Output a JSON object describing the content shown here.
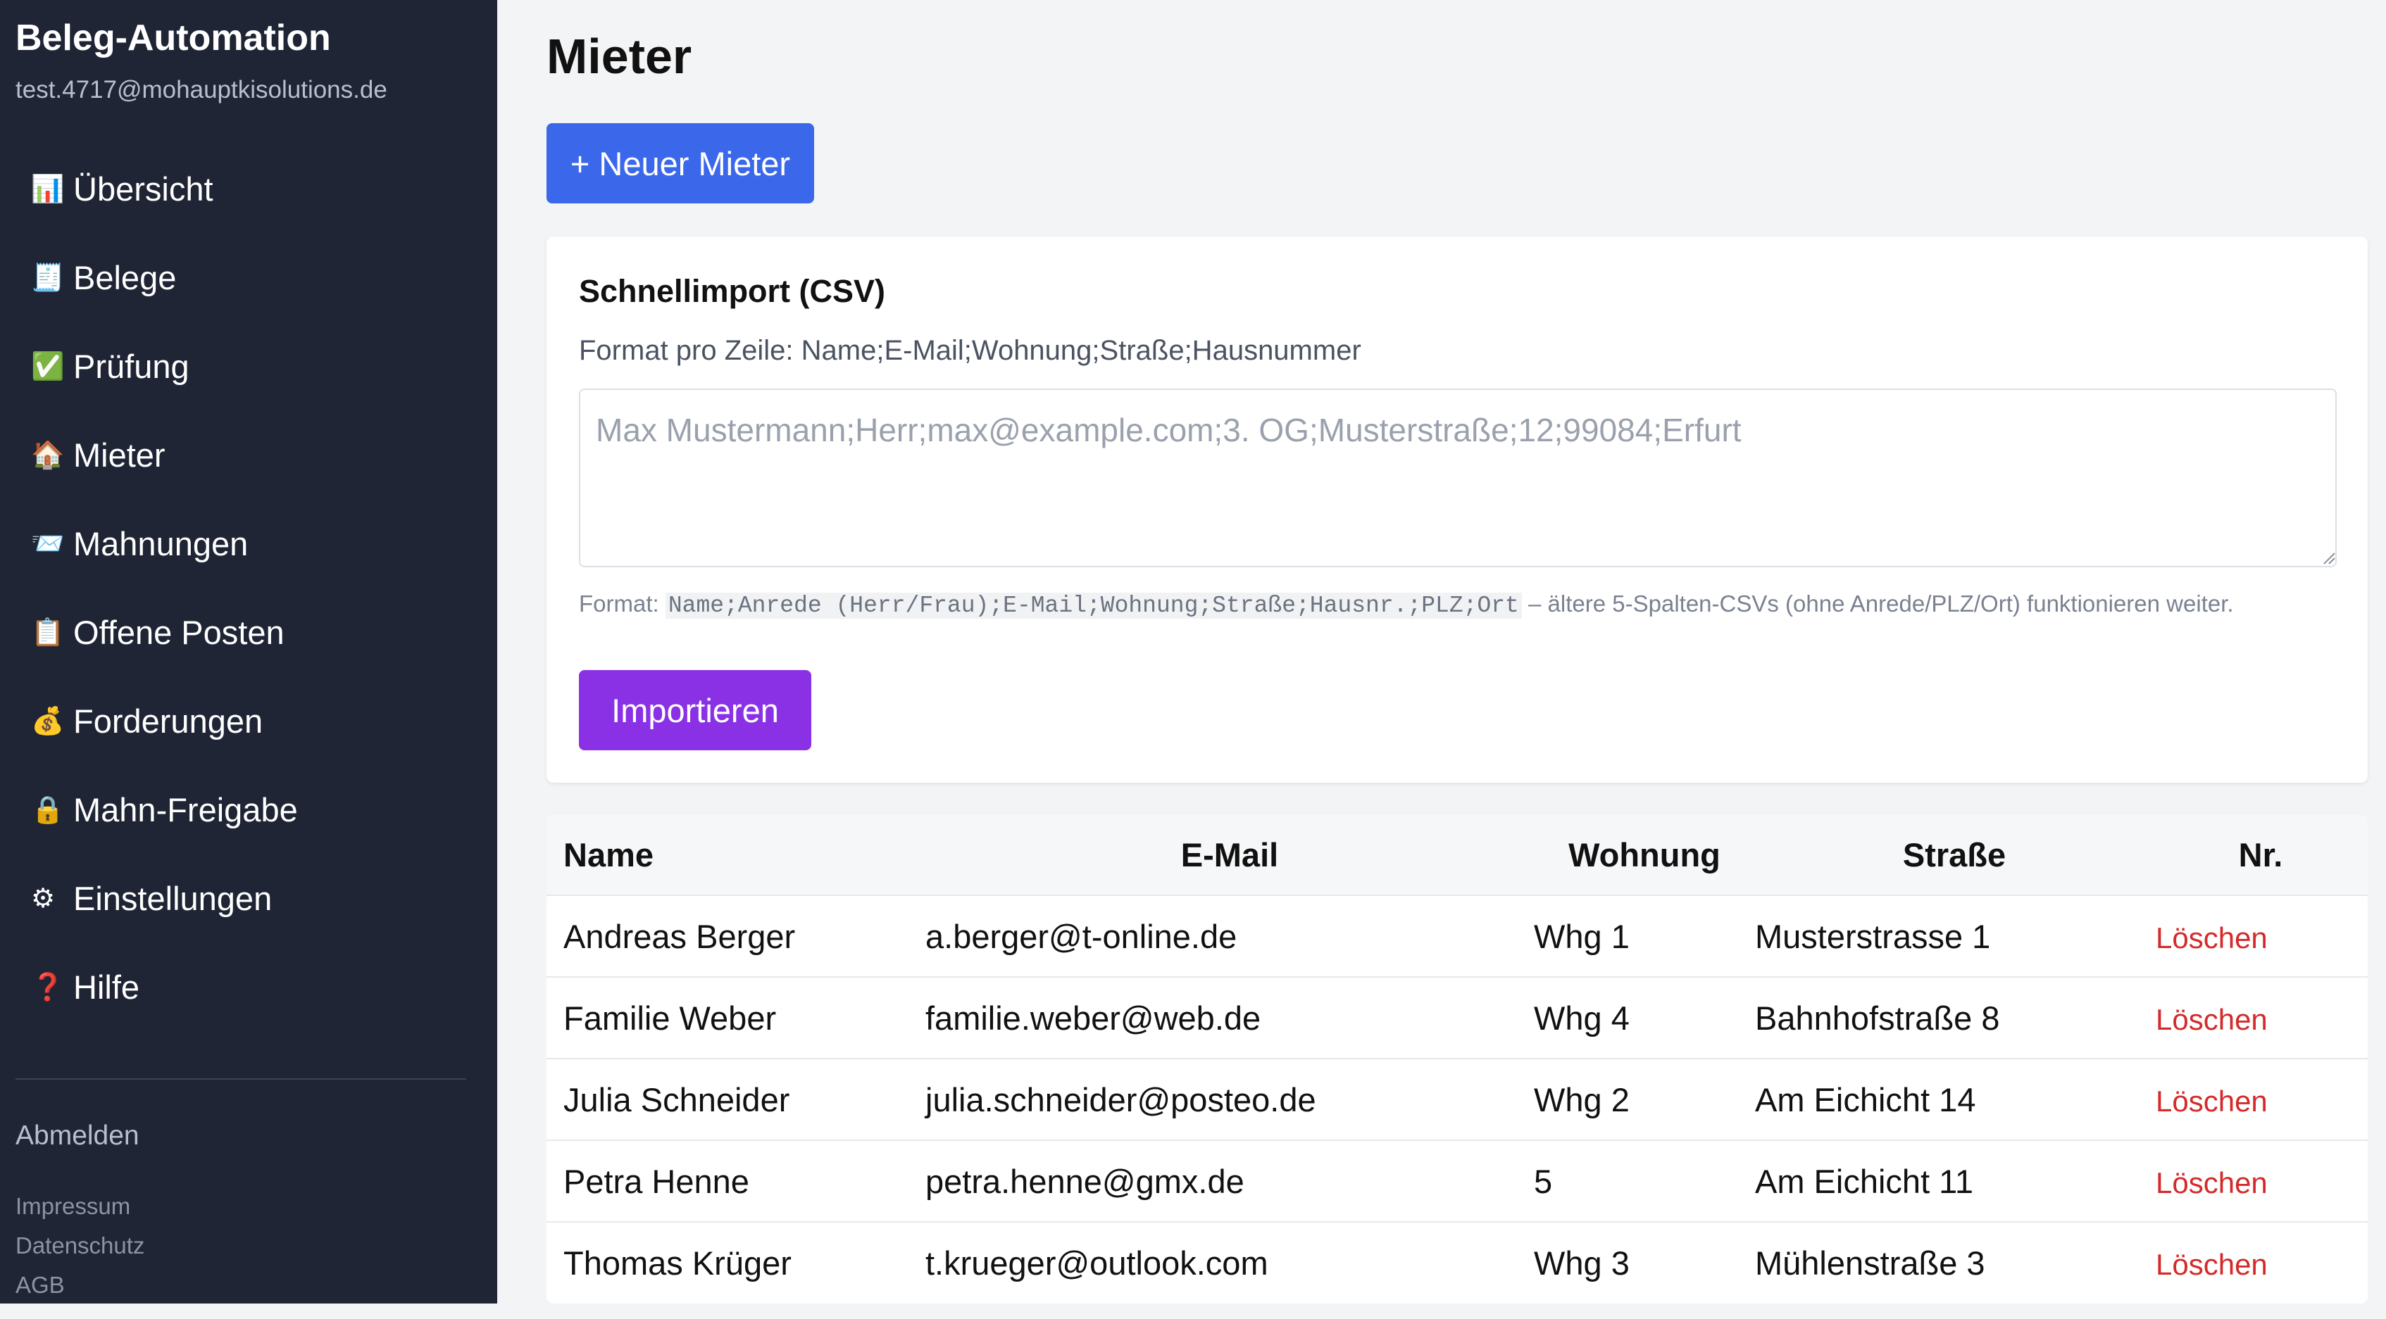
{
  "app": {
    "brand": "Beleg-Automation",
    "user_email": "test.4717@mohauptkisolutions.de"
  },
  "sidebar": {
    "items": [
      {
        "label": "Übersicht",
        "icon": "bar-chart-icon",
        "glyph": "📊"
      },
      {
        "label": "Belege",
        "icon": "receipt-icon",
        "glyph": "🧾"
      },
      {
        "label": "Prüfung",
        "icon": "check-mark-icon",
        "glyph": "✅"
      },
      {
        "label": "Mieter",
        "icon": "house-icon",
        "glyph": "🏠"
      },
      {
        "label": "Mahnungen",
        "icon": "envelope-icon",
        "glyph": "📨"
      },
      {
        "label": "Offene Posten",
        "icon": "clipboard-icon",
        "glyph": "📋"
      },
      {
        "label": "Forderungen",
        "icon": "money-bag-icon",
        "glyph": "💰"
      },
      {
        "label": "Mahn-Freigabe",
        "icon": "lock-icon",
        "glyph": "🔒"
      },
      {
        "label": "Einstellungen",
        "icon": "gear-icon",
        "glyph": "⚙"
      },
      {
        "label": "Hilfe",
        "icon": "question-mark-icon",
        "glyph": "❓"
      }
    ],
    "logout": "Abmelden",
    "footer": [
      "Impressum",
      "Datenschutz",
      "AGB"
    ]
  },
  "page": {
    "title": "Mieter",
    "new_button": "+ Neuer Mieter"
  },
  "import": {
    "title": "Schnellimport (CSV)",
    "subtitle": "Format pro Zeile: Name;E-Mail;Wohnung;Straße;Hausnummer",
    "placeholder": "Max Mustermann;Herr;max@example.com;3. OG;Musterstraße;12;99084;Erfurt",
    "value": "",
    "format_label": "Format: ",
    "format_code": "Name;Anrede (Herr/Frau);E-Mail;Wohnung;Straße;Hausnr.;PLZ;Ort",
    "format_rest": " – ältere 5-Spalten-CSVs (ohne Anrede/PLZ/Ort) funktionieren weiter.",
    "button": "Importieren"
  },
  "table": {
    "headers": [
      "Name",
      "E-Mail",
      "Wohnung",
      "Straße",
      "Nr."
    ],
    "action_label": "Löschen",
    "rows": [
      {
        "name": "Andreas Berger",
        "email": "a.berger@t-online.de",
        "flat": "Whg 1",
        "street": "Musterstrasse 1"
      },
      {
        "name": "Familie Weber",
        "email": "familie.weber@web.de",
        "flat": "Whg 4",
        "street": "Bahnhofstraße 8"
      },
      {
        "name": "Julia Schneider",
        "email": "julia.schneider@posteo.de",
        "flat": "Whg 2",
        "street": "Am Eichicht 14"
      },
      {
        "name": "Petra Henne",
        "email": "petra.henne@gmx.de",
        "flat": "5",
        "street": "Am Eichicht 11"
      },
      {
        "name": "Thomas Krüger",
        "email": "t.krueger@outlook.com",
        "flat": "Whg 3",
        "street": "Mühlenstraße 3"
      }
    ]
  },
  "colors": {
    "sidebar_bg": "#1f2535",
    "primary_button": "#3b68ea",
    "import_button": "#8a31e6",
    "delete_link": "#d42a2a"
  }
}
